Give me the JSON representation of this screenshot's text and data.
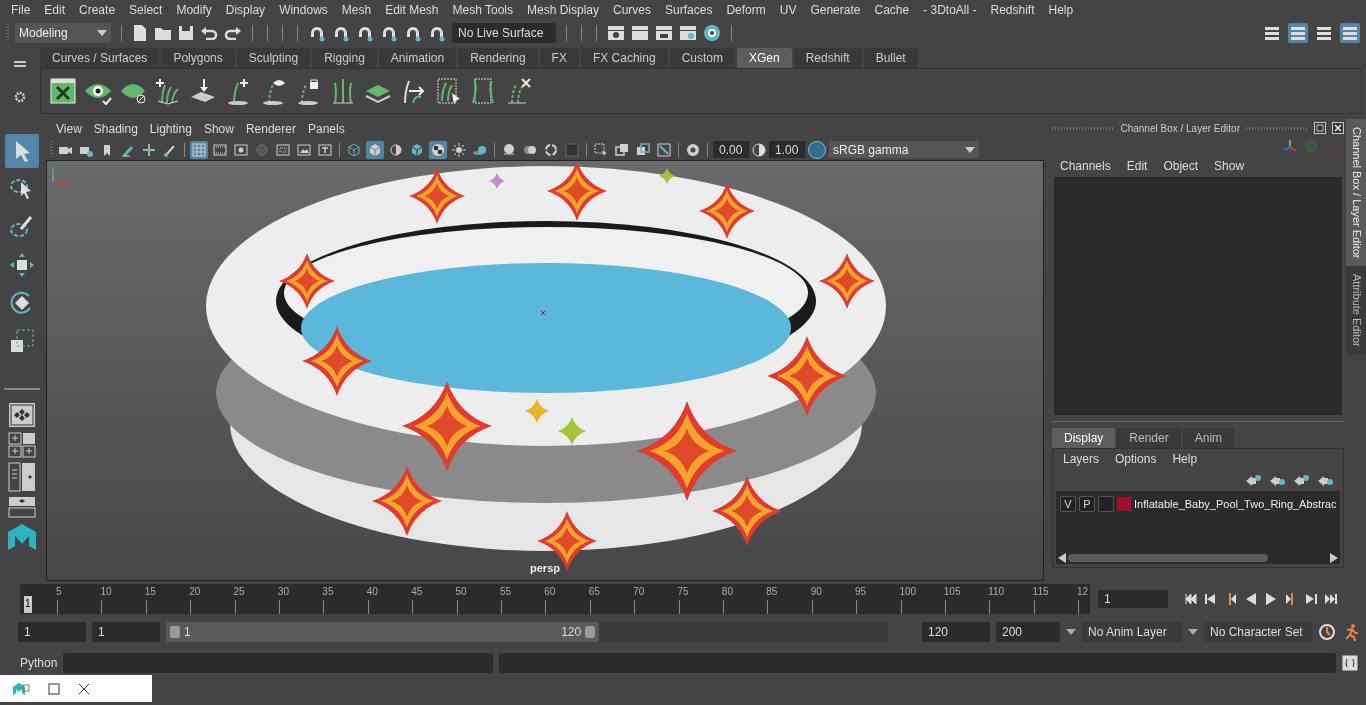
{
  "menu_bar": [
    "File",
    "Edit",
    "Create",
    "Select",
    "Modify",
    "Display",
    "Windows",
    "Mesh",
    "Edit Mesh",
    "Mesh Tools",
    "Mesh Display",
    "Curves",
    "Surfaces",
    "Deform",
    "UV",
    "Generate",
    "Cache",
    "- 3DtoAll -",
    "Redshift",
    "Help"
  ],
  "status_line": {
    "workspace": "Modeling",
    "live_surface": "No Live Surface",
    "panel_toggles": [
      {
        "on": false
      },
      {
        "on": true
      },
      {
        "on": false
      },
      {
        "on": true
      }
    ]
  },
  "shelf": {
    "tabs": [
      {
        "label": "Curves / Surfaces",
        "selected": false
      },
      {
        "label": "Polygons",
        "selected": false
      },
      {
        "label": "Sculpting",
        "selected": false
      },
      {
        "label": "Rigging",
        "selected": false
      },
      {
        "label": "Animation",
        "selected": false
      },
      {
        "label": "Rendering",
        "selected": false
      },
      {
        "label": "FX",
        "selected": false
      },
      {
        "label": "FX Caching",
        "selected": false
      },
      {
        "label": "Custom",
        "selected": false
      },
      {
        "label": "XGen",
        "selected": true
      },
      {
        "label": "Redshift",
        "selected": false
      },
      {
        "label": "Bullet",
        "selected": false
      }
    ]
  },
  "tools": [
    {
      "selected": true
    },
    {
      "selected": false
    },
    {
      "selected": false
    },
    {
      "selected": false
    },
    {
      "selected": false
    },
    {
      "selected": false
    }
  ],
  "viewport": {
    "menu": [
      "View",
      "Shading",
      "Lighting",
      "Show",
      "Renderer",
      "Panels"
    ],
    "buttons": [
      {
        "on": false
      },
      {
        "on": false
      },
      {
        "on": false
      },
      {
        "on": false
      },
      {
        "on": false
      },
      {
        "on": false
      },
      {
        "on": true
      },
      {
        "on": false
      },
      {
        "on": false
      },
      {
        "on": false
      },
      {
        "on": false
      },
      {
        "on": false
      },
      {
        "on": false
      },
      {
        "on": false
      },
      {
        "on": true
      },
      {
        "on": false
      },
      {
        "on": false
      },
      {
        "on": true
      },
      {
        "on": false
      },
      {
        "on": false
      },
      {
        "on": false
      },
      {
        "on": false
      },
      {
        "on": false
      },
      {
        "on": false
      },
      {
        "on": false
      },
      {
        "on": false
      },
      {
        "on": false
      },
      {
        "on": false
      },
      {
        "on": false
      }
    ],
    "exposure": "0.00",
    "gamma": "1.00",
    "color_management_on": true,
    "color_space": "sRGB gamma",
    "camera_label": "persp"
  },
  "channel_box": {
    "title": "Channel Box / Layer Editor",
    "side_tabs": [
      {
        "label": "Channel Box / Layer Editor",
        "selected": true
      },
      {
        "label": "Attribute Editor",
        "selected": false
      }
    ],
    "menu": [
      "Channels",
      "Edit",
      "Object",
      "Show"
    ],
    "layer_tabs": [
      {
        "label": "Display",
        "selected": true
      },
      {
        "label": "Render",
        "selected": false
      },
      {
        "label": "Anim",
        "selected": false
      }
    ],
    "layer_menu": [
      "Layers",
      "Options",
      "Help"
    ],
    "layers": [
      {
        "visibility": "V",
        "playback": "P",
        "color": "#a50d2c",
        "name": "Inflatable_Baby_Pool_Two_Ring_Abstrac"
      }
    ]
  },
  "timeline": {
    "start_label": "1",
    "ticks": [
      "5",
      "10",
      "15",
      "20",
      "25",
      "30",
      "35",
      "40",
      "45",
      "50",
      "55",
      "60",
      "65",
      "70",
      "75",
      "80",
      "85",
      "90",
      "95",
      "100",
      "105",
      "110",
      "115",
      "12"
    ],
    "current_frame": "1",
    "level": 0
  },
  "range": {
    "start": "1",
    "playback_start": "1",
    "slider_start": "1",
    "slider_end": "120",
    "level": 0.6,
    "playback_end": "120",
    "end": "200",
    "anim_layer": "No Anim Layer",
    "character_set": "No Character Set"
  },
  "command_line": {
    "label": "Python"
  }
}
